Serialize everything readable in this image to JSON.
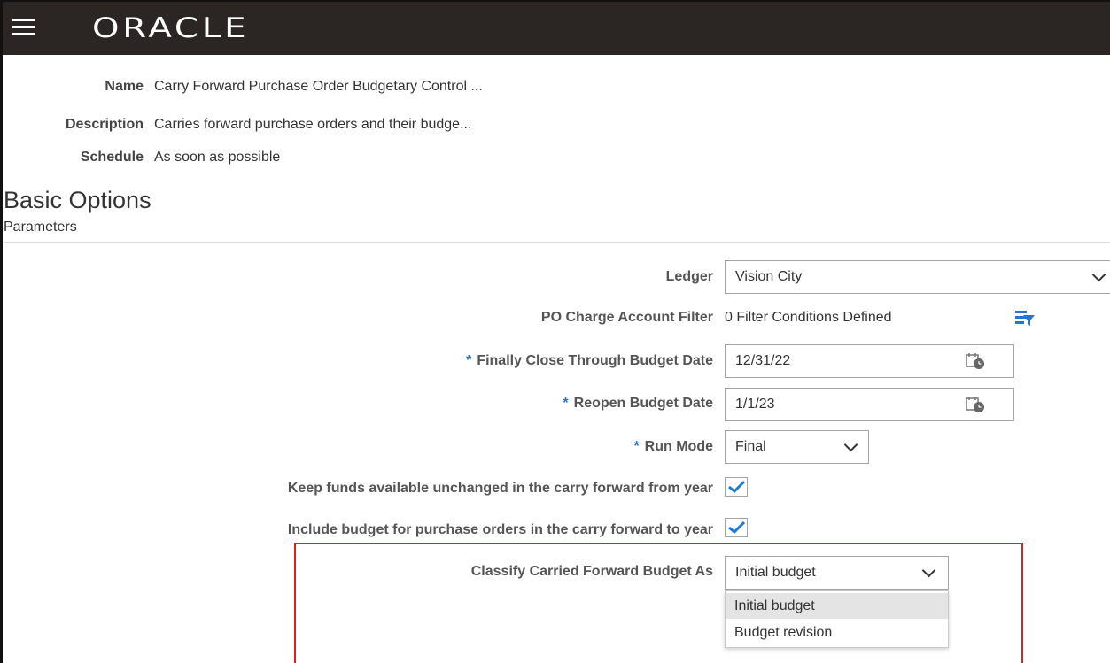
{
  "app": {
    "brand": "ORACLE"
  },
  "job": {
    "name_label": "Name",
    "name_value": "Carry Forward Purchase Order Budgetary Control ...",
    "description_label": "Description",
    "description_value": "Carries forward purchase orders and their budge...",
    "schedule_label": "Schedule",
    "schedule_value": "As soon as possible"
  },
  "section": {
    "title": "Basic Options",
    "subtitle": "Parameters"
  },
  "params": {
    "ledger_label": "Ledger",
    "ledger_value": "Vision City",
    "po_filter_label": "PO Charge Account Filter",
    "po_filter_value": "0 Filter Conditions Defined",
    "close_date_label": "Finally Close Through Budget Date",
    "close_date_value": "12/31/22",
    "reopen_date_label": "Reopen Budget Date",
    "reopen_date_value": "1/1/23",
    "run_mode_label": "Run Mode",
    "run_mode_value": "Final",
    "keep_funds_label": "Keep funds available unchanged in the carry forward from year",
    "keep_funds_checked": true,
    "include_budget_label": "Include budget for purchase orders in the carry forward to year",
    "include_budget_checked": true,
    "classify_label": "Classify Carried Forward Budget As",
    "classify_value": "Initial budget",
    "classify_options": [
      "Initial budget",
      "Budget revision"
    ],
    "required_marker": "*"
  },
  "colors": {
    "topbar": "#2b2624",
    "required": "#2a74c9",
    "checkmark": "#1e7ad4",
    "highlight": "#e0201f"
  }
}
